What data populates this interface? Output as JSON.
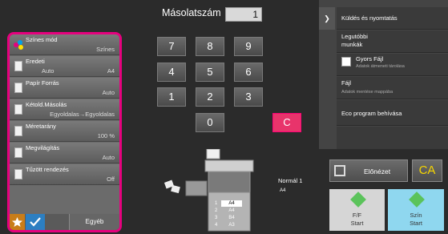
{
  "settings": [
    {
      "label": "Színes mód",
      "value": "Színes"
    },
    {
      "label": "Eredeti",
      "value_left": "Auto",
      "value": "A4"
    },
    {
      "label": "Papír Forrás",
      "value": "Auto"
    },
    {
      "label": "Kétold.Másolás",
      "value": "Egyoldalas→Egyoldalas"
    },
    {
      "label": "Méretarány",
      "value": "100 %"
    },
    {
      "label": "Megvilágítás",
      "value": "Auto"
    },
    {
      "label": "Tűzött rendezés",
      "value": "Off"
    }
  ],
  "bottom_bar": {
    "other_label": "Egyéb",
    "star_icon": "star-icon",
    "check_icon": "check-icon"
  },
  "copies": {
    "label": "Másolatszám",
    "value": "1"
  },
  "keypad": [
    "7",
    "8",
    "9",
    "4",
    "5",
    "6",
    "1",
    "2",
    "3",
    "0",
    "C"
  ],
  "menu": {
    "send_print": "Küldés és nyomtatás",
    "recent_jobs": "Legutóbbi\nmunkák",
    "quick_file": "Gyors Fájl",
    "quick_file_sub": "Adatok átmeneti tárolása",
    "file": "Fájl",
    "file_sub": "Adatok mentése mappába",
    "eco": "Eco program behívása"
  },
  "preview_label": "Előnézet",
  "ca_label": "CA",
  "start_bw": {
    "line1": "F/F",
    "line2": "Start"
  },
  "start_color": {
    "line1": "Szín",
    "line2": "Start"
  },
  "output": {
    "mode": "Normál 1",
    "paper": "A4"
  },
  "trays": [
    {
      "num": "1",
      "size": "A4"
    },
    {
      "num": "2",
      "size": "A4"
    },
    {
      "num": "3",
      "size": "B4"
    },
    {
      "num": "4",
      "size": "A3"
    }
  ],
  "colors": {
    "accent": "#e6007e",
    "clear_key": "#e8346b",
    "ca_text": "#f5d400",
    "color_start": "#8fd7ef"
  }
}
